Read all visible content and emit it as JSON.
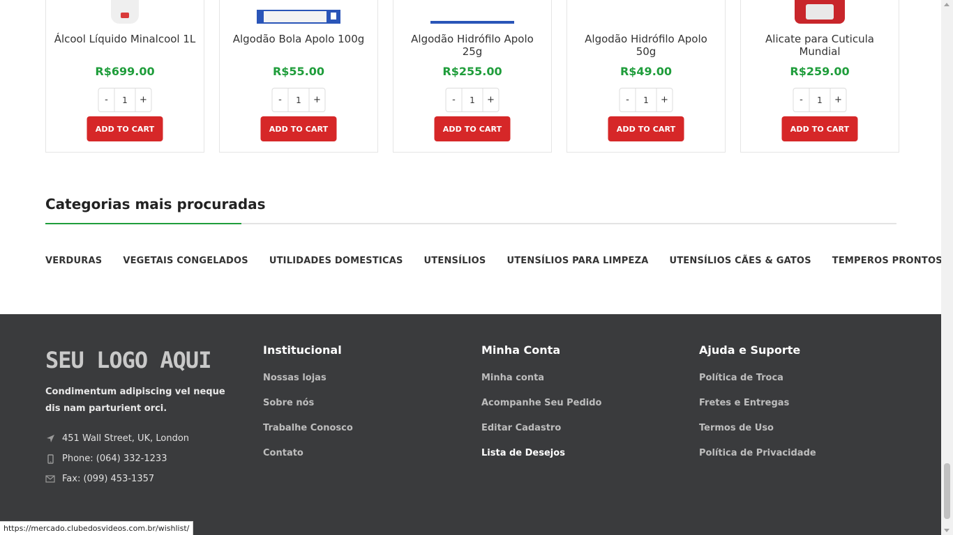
{
  "products": [
    {
      "name": "Álcool Líquido Minalcool 1L",
      "price": "R$699.00",
      "qty": "1",
      "cart_label": "ADD TO CART",
      "thumb_color": "#e8e8e8"
    },
    {
      "name": "Algodão Bola Apolo 100g",
      "price": "R$55.00",
      "qty": "1",
      "cart_label": "ADD TO CART",
      "thumb_color": "#2a55b8"
    },
    {
      "name": "Algodão Hidrófilo Apolo 25g",
      "price": "R$255.00",
      "qty": "1",
      "cart_label": "ADD TO CART",
      "thumb_color": "#2a55b8"
    },
    {
      "name": "Algodão Hidrófilo Apolo 50g",
      "price": "R$49.00",
      "qty": "1",
      "cart_label": "ADD TO CART",
      "thumb_color": "#ffffff"
    },
    {
      "name": "Alicate para Cuticula Mundial",
      "price": "R$259.00",
      "qty": "1",
      "cart_label": "ADD TO CART",
      "thumb_color": "#c8262b"
    }
  ],
  "qty_minus": "-",
  "qty_plus": "+",
  "categories": {
    "title": "Categorias mais procuradas",
    "items": [
      "VERDURAS",
      "VEGETAIS CONGELADOS",
      "UTILIDADES DOMESTICAS",
      "UTENSÍLIOS",
      "UTENSÍLIOS PARA LIMPEZA",
      "UTENSÍLIOS CÃES & GATOS",
      "TEMPEROS PRONTOS"
    ]
  },
  "footer": {
    "logo": "SEU LOGO AQUI",
    "tagline": "Condimentum adipiscing vel neque dis nam parturient orci.",
    "address": "451 Wall Street, UK, London",
    "phone": "Phone: (064) 332-1233",
    "fax": "Fax: (099) 453-1357",
    "columns": [
      {
        "title": "Institucional",
        "links": [
          "Nossas lojas",
          "Sobre nós",
          "Trabalhe Conosco",
          "Contato"
        ]
      },
      {
        "title": "Minha Conta",
        "links": [
          "Minha conta",
          "Acompanhe Seu Pedido",
          "Editar Cadastro",
          "Lista de Desejos"
        ]
      },
      {
        "title": "Ajuda e Suporte",
        "links": [
          "Política de Troca",
          "Fretes e Entregas",
          "Termos de Uso",
          "Política de Privacidade"
        ]
      }
    ]
  },
  "status_url": "https://mercado.clubedosvideos.com.br/wishlist/",
  "colors": {
    "accent_green": "#1f9d3b",
    "cart_red": "#d62728",
    "footer_bg": "#3a3b3d"
  }
}
